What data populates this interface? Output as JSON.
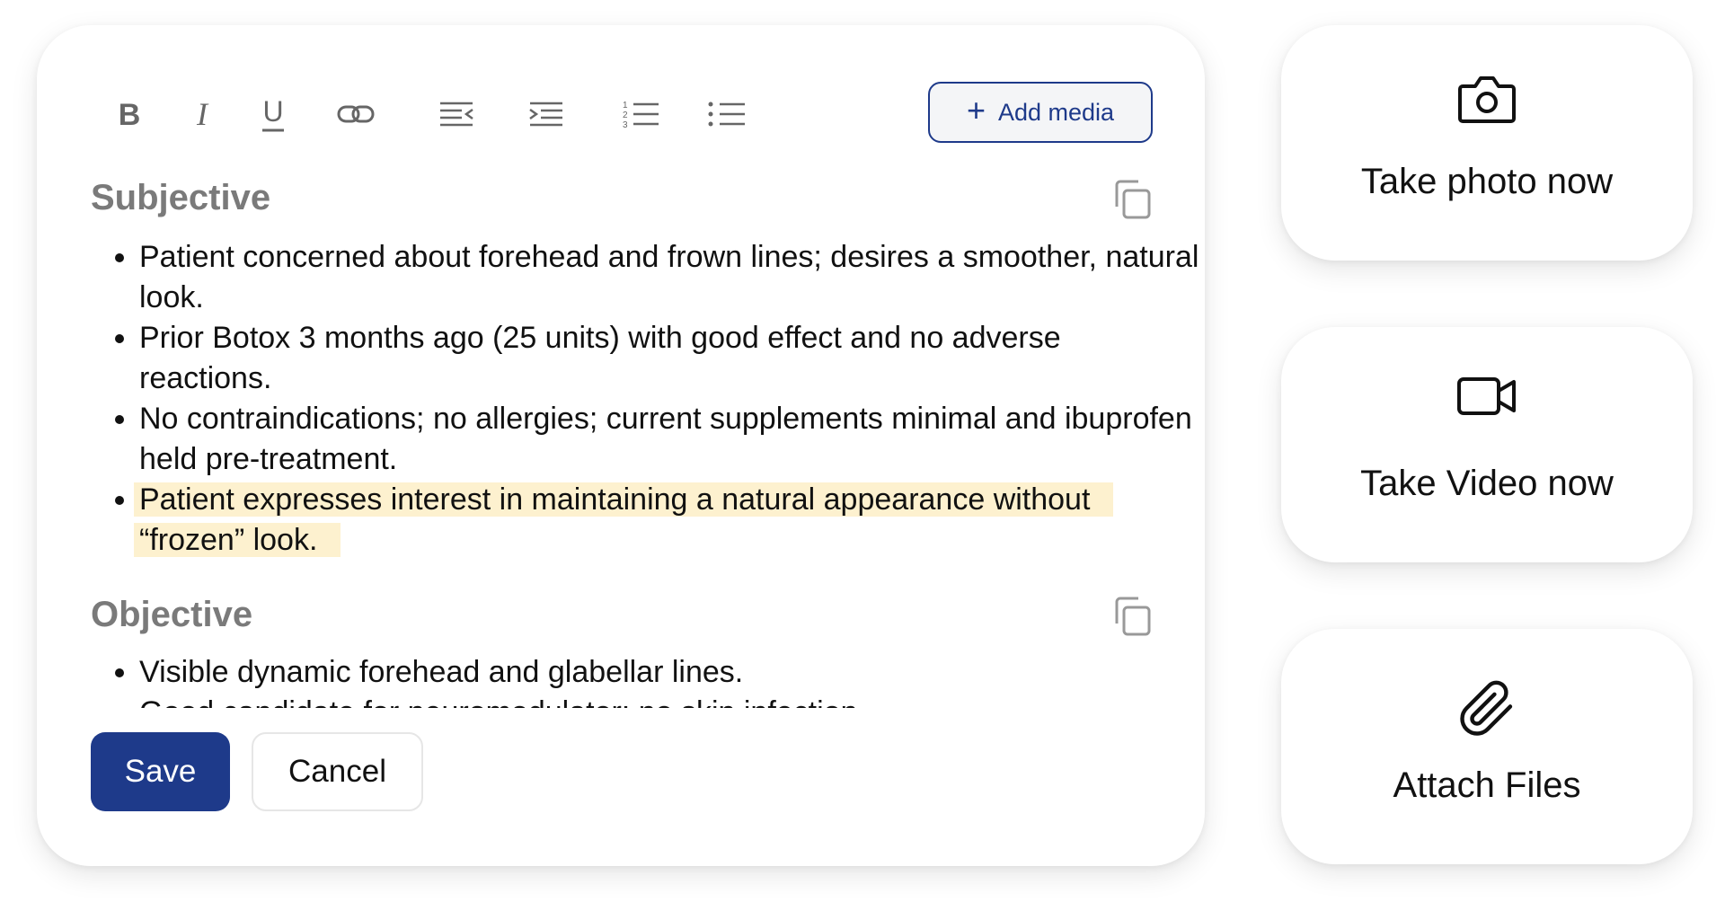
{
  "toolbar": {
    "buttons": [
      {
        "name": "bold",
        "icon": "bold-icon"
      },
      {
        "name": "italic",
        "icon": "italic-icon"
      },
      {
        "name": "underline",
        "icon": "underline-icon"
      },
      {
        "name": "link",
        "icon": "link-icon"
      },
      {
        "name": "outdent",
        "icon": "outdent-icon"
      },
      {
        "name": "indent",
        "icon": "indent-icon"
      },
      {
        "name": "numbered-list",
        "icon": "numbered-list-icon"
      },
      {
        "name": "bulleted-list",
        "icon": "bulleted-list-icon"
      }
    ],
    "add_media": {
      "label": "Add media",
      "icon": "plus-icon"
    }
  },
  "subjective": {
    "title": "Subjective",
    "copy_icon": "copy-icon",
    "items": [
      "Patient concerned about forehead and frown lines; desires a smoother, natural look.",
      "Prior Botox 3 months ago (25 units) with good effect and no adverse reactions.",
      "No contraindications; no allergies; current supplements minimal and ibuprofen held pre-treatment.",
      "Patient expresses interest in maintaining a natural appearance without “frozen” look."
    ],
    "highlighted_item_index": 3
  },
  "objective": {
    "title": "Objective",
    "copy_icon": "copy-icon",
    "items": [
      "Visible dynamic forehead and glabellar lines.",
      "Good candidate for neuromodulator; no skin infection."
    ]
  },
  "footer": {
    "save_label": "Save",
    "cancel_label": "Cancel"
  },
  "actions": [
    {
      "label": "Take photo now",
      "icon": "camera-icon"
    },
    {
      "label": "Take Video now",
      "icon": "video-camera-icon"
    },
    {
      "label": "Attach Files",
      "icon": "paperclip-icon"
    }
  ],
  "colors": {
    "primary": "#1e3a8a",
    "highlight": "#fdf1cf",
    "section_title": "#7a7a7a",
    "toolbar_icon": "#666666"
  }
}
